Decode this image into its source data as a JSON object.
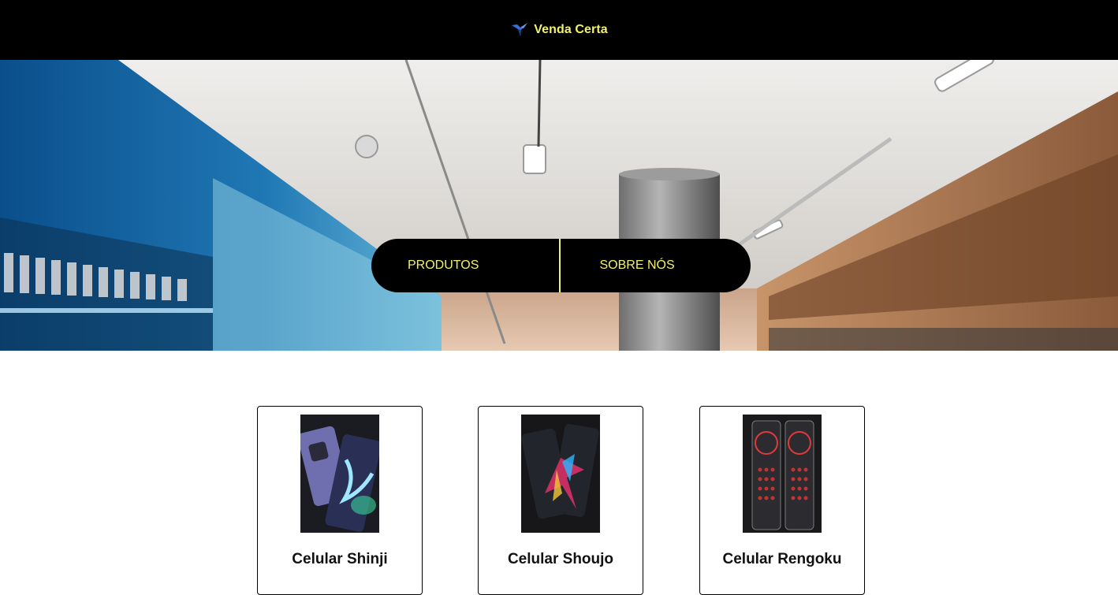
{
  "header": {
    "brand_name": "Venda Certa",
    "brand_icon": "bird-logo-icon",
    "accent_color": "#f2f26a",
    "background_color": "#000000"
  },
  "nav": {
    "items": [
      {
        "label": "PRODUTOS"
      },
      {
        "label": "SOBRE NÓS"
      }
    ]
  },
  "hero": {
    "image": "store-interior-photo"
  },
  "products": [
    {
      "title": "Celular Shinji",
      "image": "phone-shinji-photo"
    },
    {
      "title": "Celular Shoujo",
      "image": "phone-shoujo-photo"
    },
    {
      "title": "Celular Rengoku",
      "image": "phone-rengoku-photo"
    }
  ]
}
